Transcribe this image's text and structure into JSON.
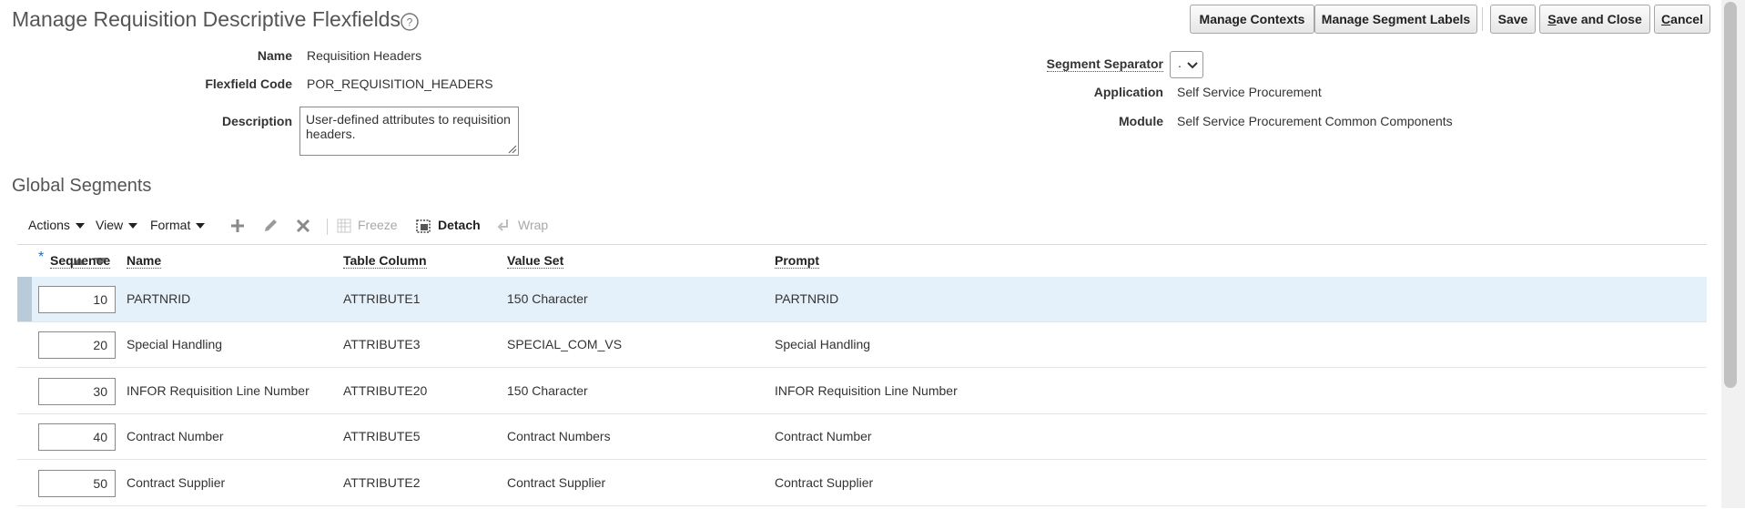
{
  "header": {
    "title": "Manage Requisition Descriptive Flexfields",
    "buttons": {
      "manage_contexts": "Manage Contexts",
      "manage_segment_labels": "Manage Segment Labels",
      "save": "Save",
      "save_and_close_accel": "S",
      "save_and_close_rest": "ave and Close",
      "cancel_accel": "C",
      "cancel_rest": "ancel"
    }
  },
  "details": {
    "name_label": "Name",
    "name_value": "Requisition Headers",
    "code_label": "Flexfield Code",
    "code_value": "POR_REQUISITION_HEADERS",
    "description_label": "Description",
    "description_value": "User-defined attributes to requisition headers.",
    "segment_separator_label": "Segment Separator",
    "segment_separator_value": ".",
    "application_label": "Application",
    "application_value": "Self Service Procurement",
    "module_label": "Module",
    "module_value": "Self Service Procurement Common Components"
  },
  "global_segments": {
    "title": "Global Segments",
    "toolbar": {
      "actions": "Actions",
      "view": "View",
      "format": "Format",
      "freeze": "Freeze",
      "detach": "Detach",
      "wrap": "Wrap"
    },
    "columns": {
      "required_marker": "*",
      "sequence": "Sequence",
      "name": "Name",
      "table_column": "Table Column",
      "value_set": "Value Set",
      "prompt": "Prompt"
    },
    "rows": [
      {
        "sequence": "10",
        "name": "PARTNRID",
        "table_column": "ATTRIBUTE1",
        "value_set": "150 Character",
        "prompt": "PARTNRID"
      },
      {
        "sequence": "20",
        "name": "Special Handling",
        "table_column": "ATTRIBUTE3",
        "value_set": "SPECIAL_COM_VS",
        "prompt": "Special Handling"
      },
      {
        "sequence": "30",
        "name": "INFOR Requisition Line Number",
        "table_column": "ATTRIBUTE20",
        "value_set": "150 Character",
        "prompt": "INFOR Requisition Line Number"
      },
      {
        "sequence": "40",
        "name": "Contract Number",
        "table_column": "ATTRIBUTE5",
        "value_set": "Contract Numbers",
        "prompt": "Contract Number"
      },
      {
        "sequence": "50",
        "name": "Contract Supplier",
        "table_column": "ATTRIBUTE2",
        "value_set": "Contract Supplier",
        "prompt": "Contract Supplier"
      }
    ]
  },
  "colors": {
    "selected_row": "#e4f0fa",
    "row_marker": "#b9cbd9",
    "required_star": "#2a6fb6"
  },
  "icons": [
    "help-icon",
    "add-icon",
    "edit-icon",
    "delete-icon",
    "freeze-icon",
    "detach-icon",
    "wrap-icon",
    "sort-icon",
    "resize-grip-icon",
    "chevron-down-icon"
  ]
}
